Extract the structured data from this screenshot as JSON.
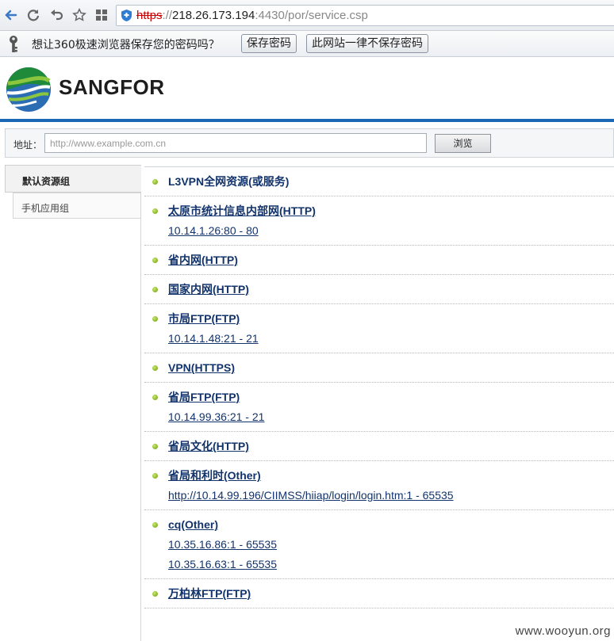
{
  "browser": {
    "url_protocol": "https",
    "url_sep": "://",
    "url_host": "218.26.173.194",
    "url_rest": ":4430/por/service.csp"
  },
  "password_bar": {
    "message": "想让360极速浏览器保存您的密码吗？",
    "save_label": "保存密码",
    "never_label": "此网站一律不保存密码"
  },
  "header": {
    "brand": "SANGFOR"
  },
  "address_row": {
    "label": "地址：",
    "placeholder": "http://www.example.com.cn",
    "browse_label": "浏览"
  },
  "tabs": [
    {
      "label": "默认资源组"
    },
    {
      "label": "手机应用组"
    }
  ],
  "resources": [
    {
      "name": "L3VPN全网资源(或服务)",
      "addresses": []
    },
    {
      "name": "太原市统计信息内部网(HTTP)",
      "addresses": [
        "10.14.1.26:80 - 80"
      ]
    },
    {
      "name": "省内网(HTTP)",
      "addresses": []
    },
    {
      "name": "国家内网(HTTP)",
      "addresses": []
    },
    {
      "name": "市局FTP(FTP)",
      "addresses": [
        "10.14.1.48:21 - 21"
      ]
    },
    {
      "name": "VPN(HTTPS)",
      "addresses": []
    },
    {
      "name": "省局FTP(FTP)",
      "addresses": [
        "10.14.99.36:21 - 21"
      ]
    },
    {
      "name": "省局文化(HTTP)",
      "addresses": []
    },
    {
      "name": "省局和利时(Other)",
      "addresses": [
        "http://10.14.99.196/CIIMSS/hiiap/login/login.htm:1 - 65535"
      ]
    },
    {
      "name": "cq(Other)",
      "addresses": [
        "10.35.16.86:1 - 65535",
        "10.35.16.63:1 - 65535"
      ]
    },
    {
      "name": "万柏林FTP(FTP)",
      "addresses": []
    }
  ],
  "watermark": "www.wooyun.org",
  "colors": {
    "header_rule": "#1a68b3",
    "link": "#12336b",
    "bullet": "#7bb21c"
  }
}
